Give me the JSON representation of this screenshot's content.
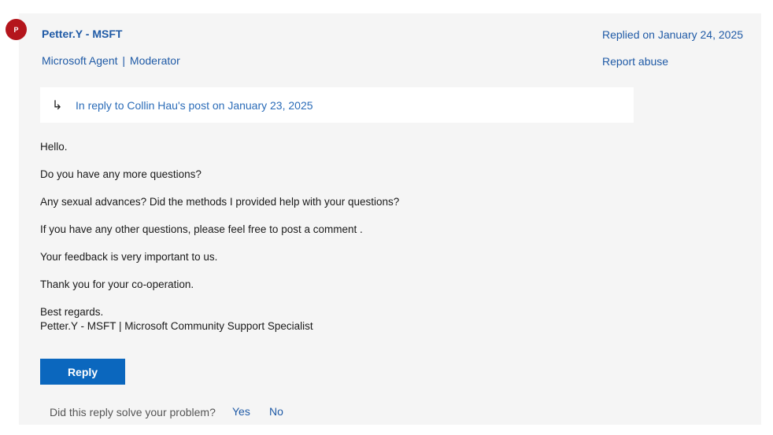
{
  "author": {
    "avatar_letter": "P",
    "name": "Petter.Y - MSFT",
    "role": "Microsoft Agent",
    "role_separator": "|",
    "badge": "Moderator"
  },
  "meta": {
    "replied": "Replied on January 24, 2025",
    "report": "Report abuse"
  },
  "in_reply": {
    "icon": "reply-arrow-icon",
    "arrow": "↳",
    "text": "In reply to Collin Hau's post on January 23, 2025"
  },
  "body": {
    "lines": [
      "Hello.",
      "Do you have any more questions?",
      "Any sexual advances? Did the methods I provided help with your questions?",
      "If you have any other questions, please feel free to post a comment .",
      "Your feedback is very important to us.",
      "Thank you for your co-operation."
    ],
    "sign_1": "Best regards.",
    "sign_2": "Petter.Y - MSFT | Microsoft Community Support Specialist"
  },
  "actions": {
    "reply": "Reply",
    "solve_question": "Did this reply solve your problem?",
    "yes": "Yes",
    "no": "No"
  },
  "colors": {
    "accent": "#0b67be",
    "link": "#1f5aa6",
    "avatar": "#b4151c",
    "card": "#f5f5f5"
  }
}
